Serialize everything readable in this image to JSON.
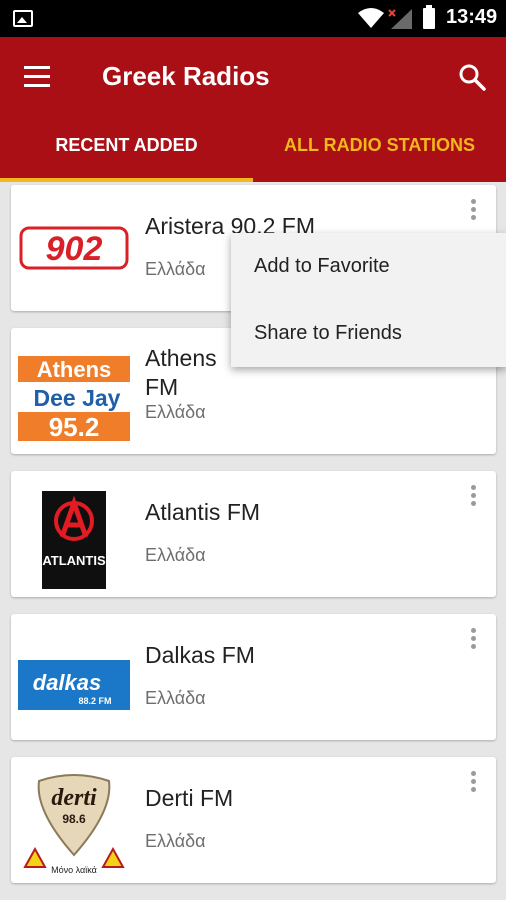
{
  "status_bar": {
    "time": "13:49",
    "icons": [
      "photo-icon",
      "wifi-icon",
      "signal-icon",
      "battery-icon"
    ]
  },
  "app_bar": {
    "title": "Greek Radios",
    "menu_icon": "menu-icon",
    "search_icon": "search-icon"
  },
  "tabs": {
    "recent": "RECENT ADDED",
    "all": "ALL RADIO STATIONS",
    "active": "RECENT ADDED"
  },
  "stations": [
    {
      "name": "Aristera 90.2 FM",
      "country": "Ελλάδα",
      "logo_text": "902"
    },
    {
      "name": "Athens DeeJay 95.2",
      "name_line1": "Athens",
      "name_line2": "FM",
      "country": "Ελλάδα",
      "logo_lines": [
        "Athens",
        "Dee Jay",
        "95.2"
      ]
    },
    {
      "name": "Atlantis FM",
      "country": "Ελλάδα",
      "logo_text": "ATLANTIS"
    },
    {
      "name": "Dalkas FM",
      "country": "Ελλάδα",
      "logo_lines": [
        "dalkas",
        "88.2 FM"
      ]
    },
    {
      "name": "Derti FM",
      "country": "Ελλάδα",
      "logo_lines": [
        "derti",
        "98.6",
        "Μόνο λαϊκά"
      ]
    }
  ],
  "popup_menu": {
    "items": [
      "Add to Favorite",
      "Share to Friends"
    ]
  },
  "colors": {
    "app_bar": "#a90f14",
    "accent": "#f2b61f",
    "background": "#e6e6e6"
  }
}
